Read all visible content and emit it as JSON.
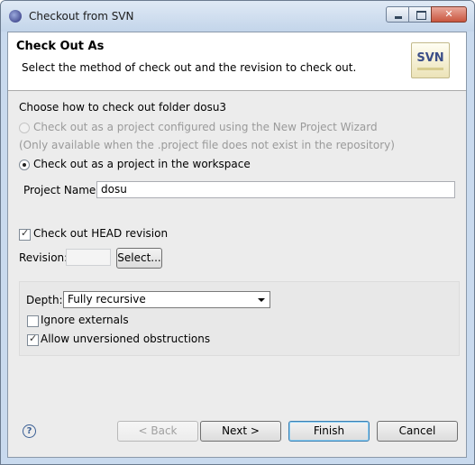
{
  "window": {
    "title": "Checkout from SVN",
    "controls": [
      "minimize",
      "maximize",
      "close"
    ]
  },
  "header": {
    "title": "Check Out As",
    "description": "Select the method of check out and the revision to check out.",
    "logo_text": "SVN"
  },
  "body": {
    "choose_label": "Choose how to check out folder dosu3",
    "option_wizard": "Check out as a project configured using the New Project Wizard",
    "option_wizard_note": "(Only available when the .project file does not exist in the repository)",
    "option_workspace": "Check out as a project in the workspace",
    "project_name_label": "Project Name:",
    "project_name_value": "dosu",
    "head_revision_label": "Check out HEAD revision",
    "head_revision_checked": true,
    "revision_label": "Revision:",
    "revision_value": "",
    "select_button": "Select...",
    "depth_label": "Depth:",
    "depth_value": "Fully recursive",
    "ignore_externals_label": "Ignore externals",
    "ignore_externals_checked": false,
    "allow_unversioned_label": "Allow unversioned obstructions",
    "allow_unversioned_checked": true
  },
  "footer": {
    "help_icon": "?",
    "back": "< Back",
    "next": "Next >",
    "finish": "Finish",
    "cancel": "Cancel"
  }
}
